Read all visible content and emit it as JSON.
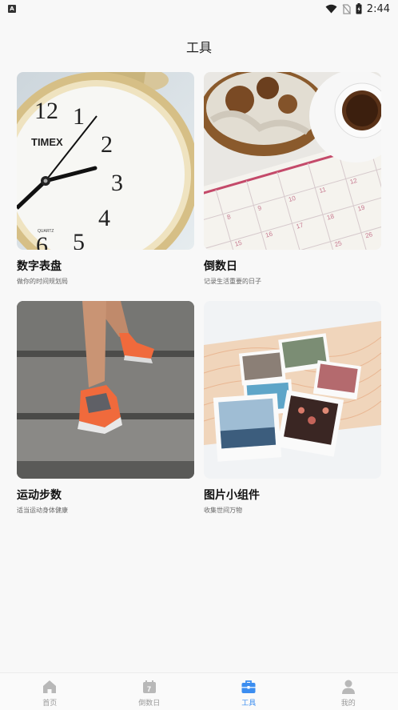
{
  "status_bar": {
    "time": "2:44",
    "app_badge": "A"
  },
  "header": {
    "title": "工具"
  },
  "tools": [
    {
      "title": "数字表盘",
      "subtitle": "做你的时间规划局",
      "image": "alarm-clock-photo"
    },
    {
      "title": "倒数日",
      "subtitle": "记录生活重要的日子",
      "image": "calendar-coffee-photo"
    },
    {
      "title": "运动步数",
      "subtitle": "适当运动身体健康",
      "image": "running-stairs-photo"
    },
    {
      "title": "图片小组件",
      "subtitle": "收集世间万物",
      "image": "polaroid-photos-photo"
    }
  ],
  "photo_text": {
    "clock_brand": "TIMEX",
    "clock_quartz": "QUARTZ"
  },
  "tabbar": {
    "items": [
      {
        "label": "首页",
        "icon": "home-icon",
        "active": false
      },
      {
        "label": "倒数日",
        "icon": "calendar-icon",
        "active": false
      },
      {
        "label": "工具",
        "icon": "toolbox-icon",
        "active": true
      },
      {
        "label": "我的",
        "icon": "person-icon",
        "active": false
      }
    ],
    "calendar_glyph": "7"
  },
  "colors": {
    "accent": "#3b8df0",
    "inactive": "#999999",
    "background": "#f8f8f8"
  }
}
